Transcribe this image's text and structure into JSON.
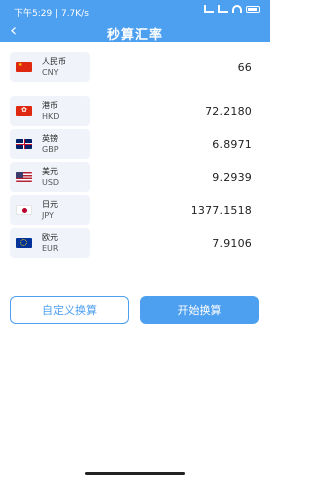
{
  "status_bar": {
    "time": "下午5:29 | 7.7K/s"
  },
  "nav": {
    "title": "秒算汇率",
    "back_icon": "‹"
  },
  "base_currency": {
    "name": "人民币",
    "code": "CNY",
    "amount": "66"
  },
  "rates": [
    {
      "name": "港币",
      "code": "HKD",
      "value": "72.2180"
    },
    {
      "name": "英镑",
      "code": "GBP",
      "value": "6.8971"
    },
    {
      "name": "美元",
      "code": "USD",
      "value": "9.2939"
    },
    {
      "name": "日元",
      "code": "JPY",
      "value": "1377.1518"
    },
    {
      "name": "欧元",
      "code": "EUR",
      "value": "7.9106"
    }
  ],
  "buttons": {
    "custom": "自定义换算",
    "start": "开始换算"
  },
  "colors": {
    "brand": "#4d9ff0"
  }
}
